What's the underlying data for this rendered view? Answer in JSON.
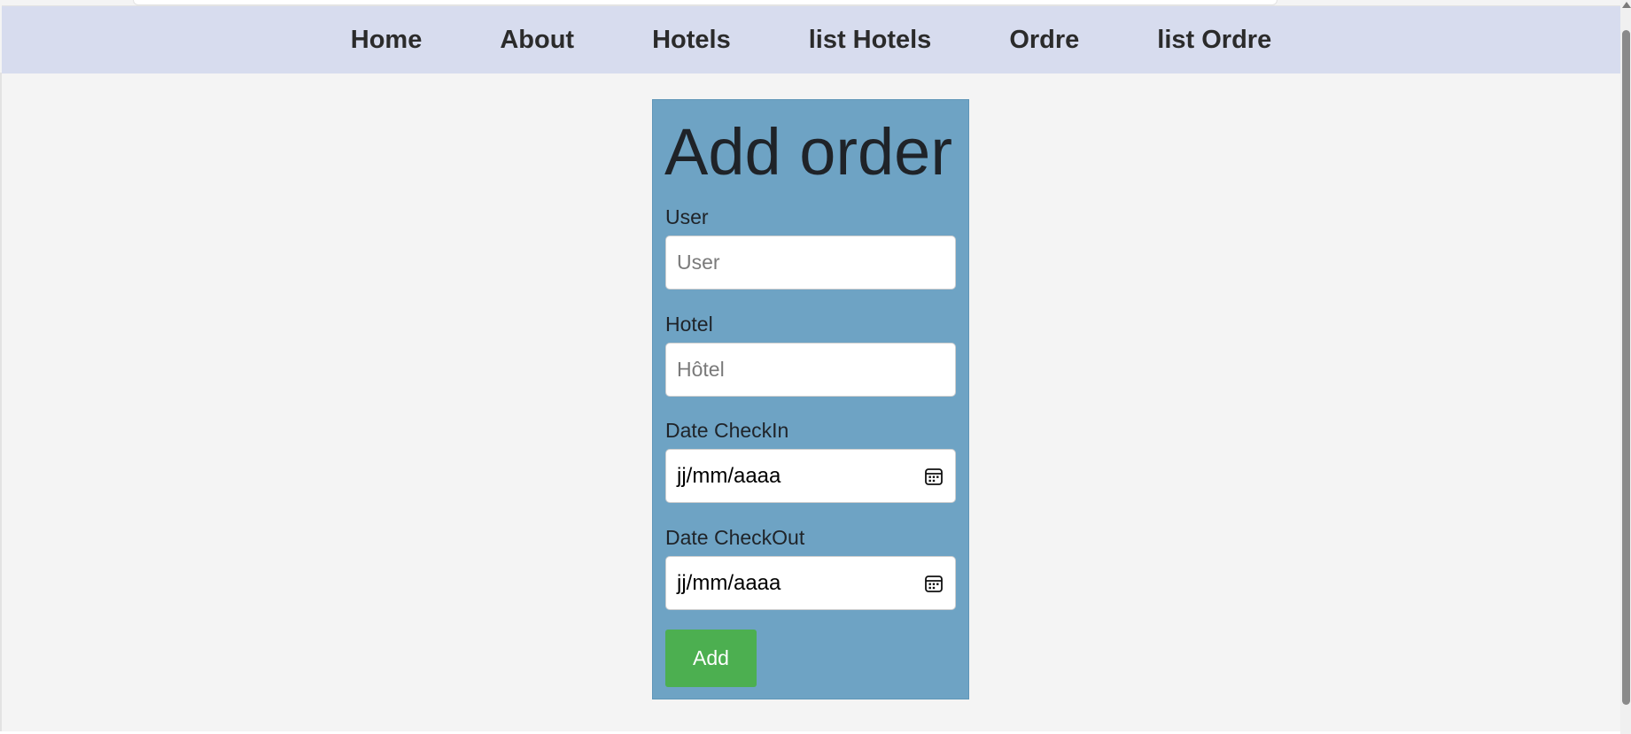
{
  "nav": {
    "items": [
      {
        "label": "Home"
      },
      {
        "label": "About"
      },
      {
        "label": "Hotels"
      },
      {
        "label": "list Hotels"
      },
      {
        "label": "Ordre"
      },
      {
        "label": "list Ordre"
      }
    ]
  },
  "form": {
    "title": "Add order",
    "user": {
      "label": "User",
      "placeholder": "User",
      "value": ""
    },
    "hotel": {
      "label": "Hotel",
      "placeholder": "Hôtel",
      "value": ""
    },
    "checkin": {
      "label": "Date CheckIn",
      "value": "jj/mm/aaaa",
      "icon": "calendar-icon"
    },
    "checkout": {
      "label": "Date CheckOut",
      "value": "jj/mm/aaaa",
      "icon": "calendar-icon"
    },
    "submit_label": "Add"
  },
  "colors": {
    "navbar_bg": "#d7dcee",
    "page_bg": "#f4f4f4",
    "card_bg": "#6ea3c4",
    "button_bg": "#4caf50"
  }
}
